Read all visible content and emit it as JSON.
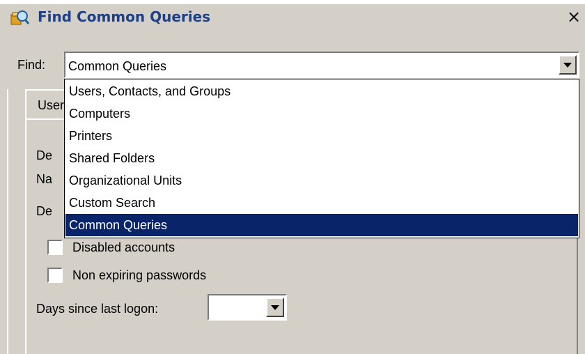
{
  "window": {
    "title": "Find Common Queries",
    "close_label": "×"
  },
  "find": {
    "label": "Find:",
    "selected_value": "Common Queries",
    "options": [
      "Users, Contacts, and Groups",
      "Computers",
      "Printers",
      "Shared Folders",
      "Organizational Units",
      "Custom Search",
      "Common Queries"
    ],
    "highlighted_option": "Common Queries"
  },
  "tab": {
    "label": "User"
  },
  "partial_labels": {
    "label1": "De",
    "label2": "Na",
    "label3": "De"
  },
  "checkboxes": [
    {
      "label": "Disabled accounts",
      "checked": false
    },
    {
      "label": "Non expiring passwords",
      "checked": false
    }
  ],
  "days_since_logon": {
    "label": "Days since last logon:",
    "value": ""
  },
  "colors": {
    "dialog_bg": "#d4d0c8",
    "title_text": "#1f3f86",
    "selection_bg": "#0a246a",
    "selection_text": "#ffffff"
  },
  "icons": {
    "title": "find-queries-icon",
    "close": "close-icon",
    "dropdown_arrow": "chevron-down-icon"
  }
}
